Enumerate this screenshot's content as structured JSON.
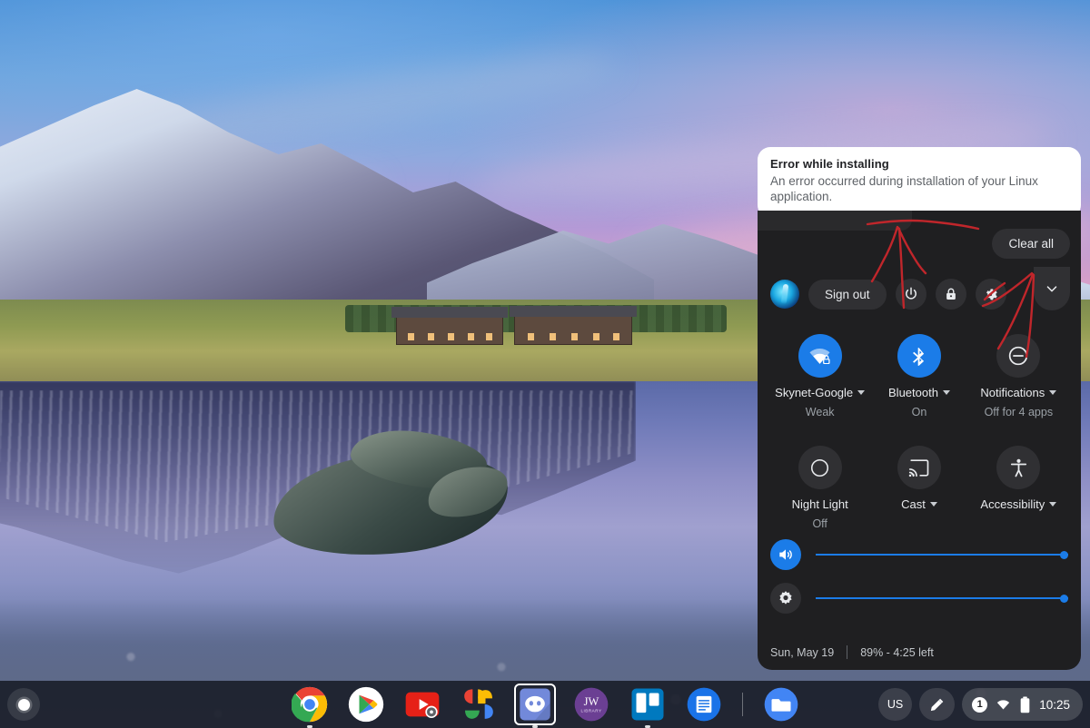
{
  "notification": {
    "title": "Error while installing",
    "body": "An error occurred during installation of your Linux application."
  },
  "tray": {
    "clear_all_label": "Clear all",
    "sign_out_label": "Sign out",
    "power_icon": "power-icon",
    "lock_icon": "lock-icon",
    "settings_icon": "gear-icon",
    "collapse_icon": "chevron-down-icon",
    "avatar_icon": "user-avatar",
    "tiles": [
      {
        "icon": "wifi-locked-icon",
        "label": "Skynet-Google",
        "sub": "Weak",
        "has_caret": true,
        "active": true
      },
      {
        "icon": "bluetooth-icon",
        "label": "Bluetooth",
        "sub": "On",
        "has_caret": true,
        "active": true
      },
      {
        "icon": "do-not-disturb-icon",
        "label": "Notifications",
        "sub": "Off for 4 apps",
        "has_caret": true,
        "active": false
      },
      {
        "icon": "night-light-icon",
        "label": "Night Light",
        "sub": "Off",
        "has_caret": false,
        "active": false
      },
      {
        "icon": "cast-icon",
        "label": "Cast",
        "sub": "",
        "has_caret": true,
        "active": false
      },
      {
        "icon": "accessibility-icon",
        "label": "Accessibility",
        "sub": "",
        "has_caret": true,
        "active": false
      }
    ],
    "sliders": [
      {
        "icon": "volume-icon",
        "name": "volume-slider",
        "value": 100
      },
      {
        "icon": "brightness-icon",
        "name": "brightness-slider",
        "value": 100
      }
    ],
    "footer": {
      "date": "Sun, May 19",
      "battery": "89% - 4:25 left"
    },
    "colors": {
      "panel_bg": "#1f1f21",
      "accent": "#1b7ce8",
      "button_bg": "#303033"
    }
  },
  "annotations": {
    "color": "#c0262b",
    "marks": [
      "arrow-up-to-power",
      "arrow-up-to-settings"
    ]
  },
  "shelf": {
    "launcher_icon": "launcher-icon",
    "apps": [
      {
        "name": "chrome",
        "icon": "chrome-icon",
        "running": true,
        "focused": false
      },
      {
        "name": "play-store",
        "icon": "play-store-icon",
        "running": false,
        "focused": false
      },
      {
        "name": "youtube",
        "icon": "youtube-icon",
        "running": false,
        "focused": false
      },
      {
        "name": "photos",
        "icon": "google-photos-icon",
        "running": false,
        "focused": false
      },
      {
        "name": "discord",
        "icon": "discord-icon",
        "running": true,
        "focused": true
      },
      {
        "name": "jw-library",
        "icon": "jw-library-icon",
        "running": false,
        "focused": false
      },
      {
        "name": "trello",
        "icon": "trello-icon",
        "running": true,
        "focused": false
      },
      {
        "name": "google-docs",
        "icon": "google-docs-icon",
        "running": false,
        "focused": false
      },
      {
        "name": "files",
        "icon": "files-icon",
        "running": false,
        "focused": false
      }
    ],
    "status": {
      "ime_label": "US",
      "stylus_icon": "stylus-pen-icon",
      "notification_count": "1",
      "wifi_icon": "wifi-icon",
      "battery_icon": "battery-icon",
      "time": "10:25"
    }
  },
  "wallpaper": {
    "description": "Mountain lake at sunset with reflection and rocks"
  }
}
